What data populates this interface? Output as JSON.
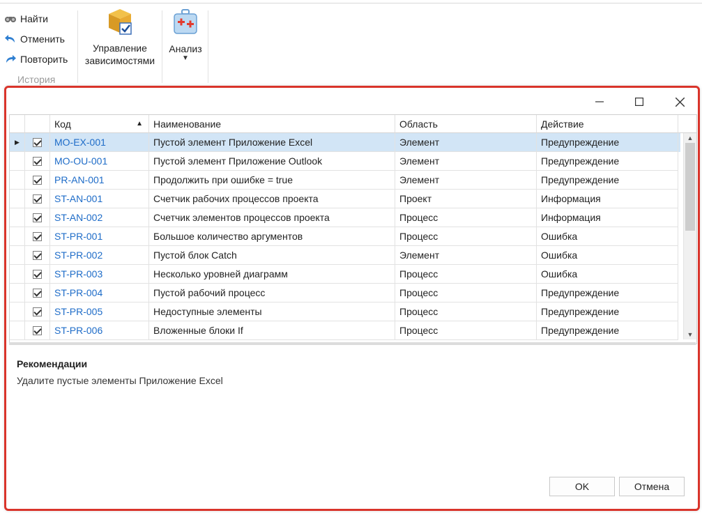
{
  "ribbon": {
    "history": {
      "find_label": "Найти",
      "undo_label": "Отменить",
      "redo_label": "Повторить",
      "group_label": "История"
    },
    "dependencies_label_line1": "Управление",
    "dependencies_label_line2": "зависимостями",
    "analyze_label": "Анализ"
  },
  "grid": {
    "columns": {
      "code": "Код",
      "name": "Наименование",
      "scope": "Область",
      "action": "Действие"
    },
    "sort_indicator": "▲",
    "rows": [
      {
        "code": "MO-EX-001",
        "name": "Пустой элемент Приложение Excel",
        "scope": "Элемент",
        "action": "Предупреждение"
      },
      {
        "code": "MO-OU-001",
        "name": "Пустой элемент Приложение Outlook",
        "scope": "Элемент",
        "action": "Предупреждение"
      },
      {
        "code": "PR-AN-001",
        "name": "Продолжить при ошибке = true",
        "scope": "Элемент",
        "action": "Предупреждение"
      },
      {
        "code": "ST-AN-001",
        "name": "Счетчик рабочих процессов проекта",
        "scope": "Проект",
        "action": "Информация"
      },
      {
        "code": "ST-AN-002",
        "name": "Счетчик элементов процессов проекта",
        "scope": "Процесс",
        "action": "Информация"
      },
      {
        "code": "ST-PR-001",
        "name": "Большое количество аргументов",
        "scope": "Процесс",
        "action": "Ошибка"
      },
      {
        "code": "ST-PR-002",
        "name": "Пустой блок Catch",
        "scope": "Элемент",
        "action": "Ошибка"
      },
      {
        "code": "ST-PR-003",
        "name": "Несколько уровней диаграмм",
        "scope": "Процесс",
        "action": "Ошибка"
      },
      {
        "code": "ST-PR-004",
        "name": "Пустой рабочий процесс",
        "scope": "Процесс",
        "action": "Предупреждение"
      },
      {
        "code": "ST-PR-005",
        "name": "Недоступные элементы",
        "scope": "Процесс",
        "action": "Предупреждение"
      },
      {
        "code": "ST-PR-006",
        "name": "Вложенные блоки If",
        "scope": "Процесс",
        "action": "Предупреждение"
      }
    ]
  },
  "recommendations": {
    "title": "Рекомендации",
    "text": "Удалите пустые элементы Приложение Excel"
  },
  "buttons": {
    "ok": "OK",
    "cancel": "Отмена"
  },
  "icons": {
    "find": "binoculars-icon",
    "undo": "undo-icon",
    "redo": "redo-icon",
    "dependencies": "package-check-icon",
    "analyze": "medkit-icon",
    "minimize": "minimize-icon",
    "maximize": "maximize-icon",
    "close": "close-icon"
  },
  "colors": {
    "accent_border": "#d9342b",
    "selected_row": "#d2e5f6",
    "link_text": "#1e6cc8"
  }
}
